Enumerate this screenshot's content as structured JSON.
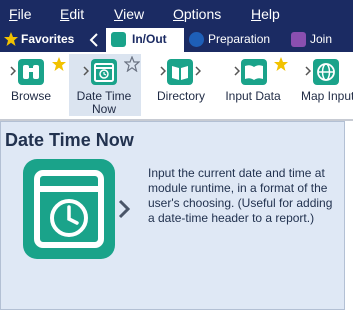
{
  "menu": {
    "items": [
      {
        "pre": "",
        "mn": "F",
        "post": "ile"
      },
      {
        "pre": "",
        "mn": "E",
        "post": "dit"
      },
      {
        "pre": "",
        "mn": "V",
        "post": "iew"
      },
      {
        "pre": "",
        "mn": "O",
        "post": "ptions"
      },
      {
        "pre": "",
        "mn": "H",
        "post": "elp"
      }
    ]
  },
  "tabs": {
    "favorites": "Favorites",
    "in_out": "In/Out",
    "preparation": "Preparation",
    "join": "Join"
  },
  "tools": {
    "browse": "Browse",
    "date_time_now_line1": "Date Time",
    "date_time_now_line2": "Now",
    "directory": "Directory",
    "input_data": "Input Data",
    "map_input": "Map Input"
  },
  "tooltip": {
    "title": "Date Time Now",
    "description": "Input the current date and time at module runtime, in a format of the user's choosing. (Useful for adding a date-time header to a report.)"
  },
  "colors": {
    "menubar": "#1b2b63",
    "tool_teal": "#1aa38a",
    "star_gold": "#f2c200",
    "in_out_tab_icon": "#1aa38a",
    "preparation_tab_icon": "#1e5fb8",
    "join_tab_icon": "#8a4fb0",
    "tooltip_bg": "#dfe8f5",
    "selected_tool_bg": "#dbe4f0"
  },
  "icons": {
    "favorites": "star-icon",
    "nav_back": "chevron-left-icon",
    "browse": "binoculars-icon",
    "date_time_now": "clock-calendar-icon",
    "directory": "folder-book-icon",
    "input_data": "open-book-icon",
    "map_input": "globe-icon"
  }
}
